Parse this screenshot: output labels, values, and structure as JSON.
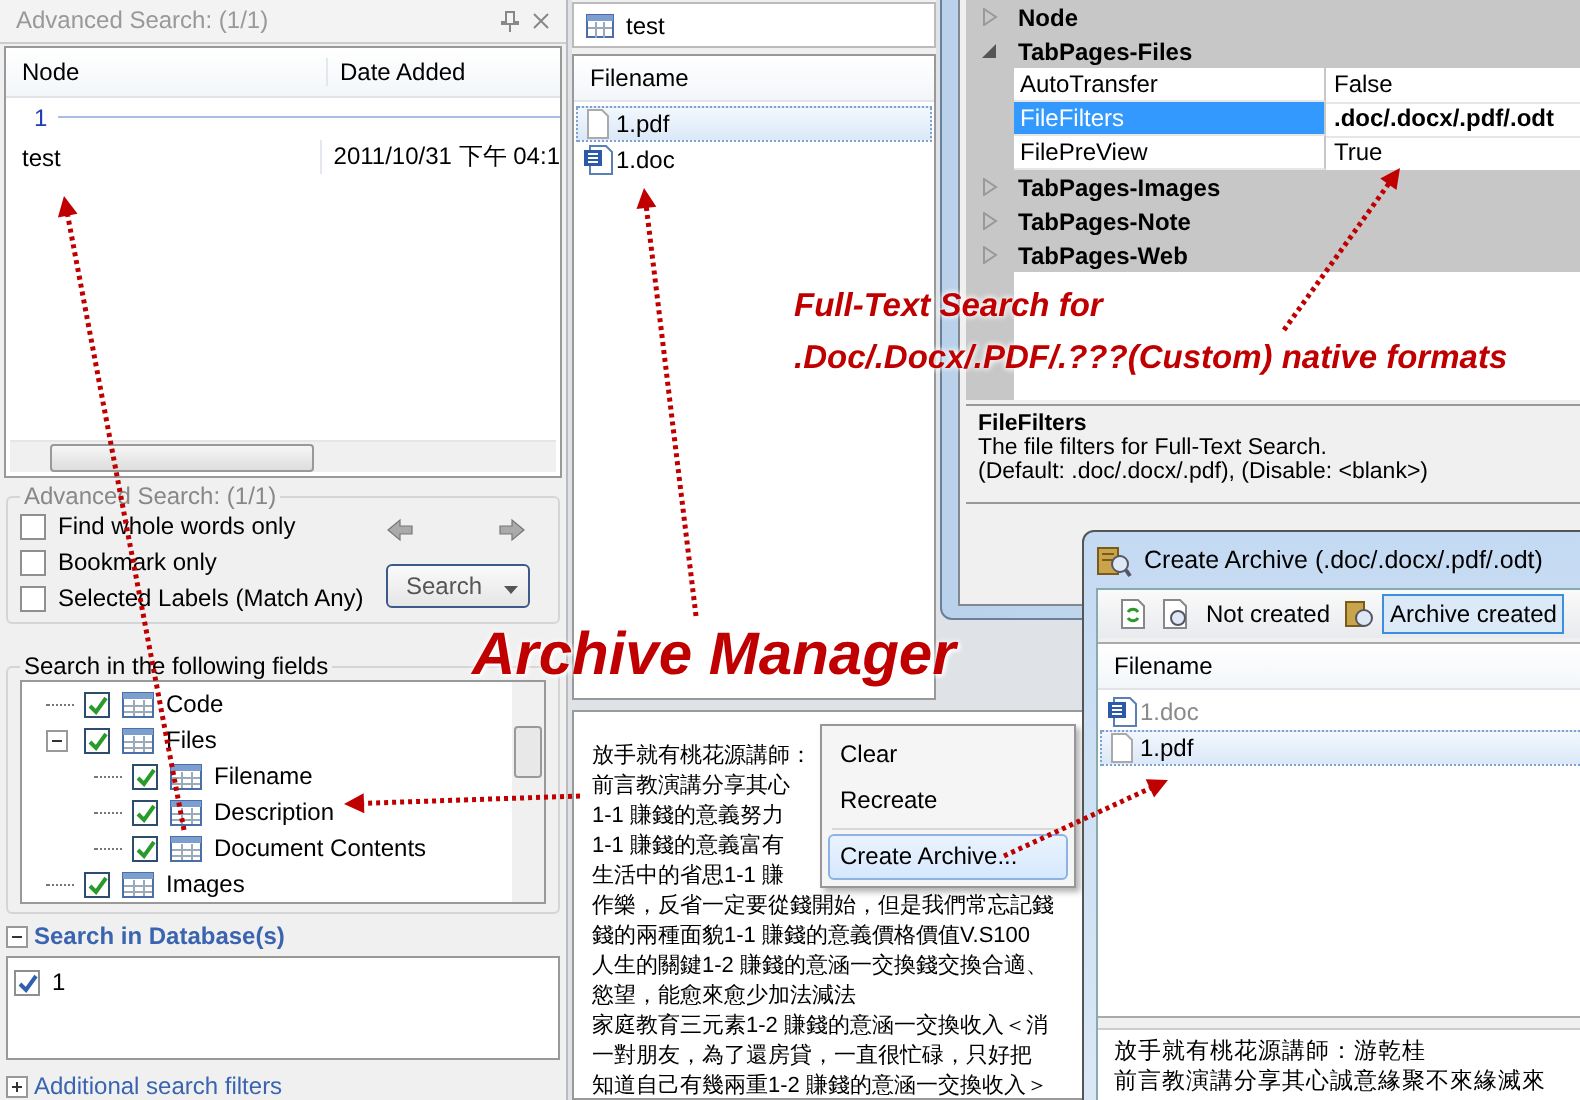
{
  "search_panel": {
    "title": "Advanced Search: (1/1)",
    "list": {
      "columns": [
        "Node",
        "Date Added"
      ],
      "group": "1",
      "rows": [
        {
          "node": "test",
          "date": "2011/10/31 下午 04:1"
        }
      ]
    },
    "options": {
      "title": "Advanced Search: (1/1)",
      "checkboxes": [
        {
          "label": "Find whole words only",
          "checked": false
        },
        {
          "label": "Bookmark only",
          "checked": false
        },
        {
          "label": "Selected Labels (Match Any)",
          "checked": false
        }
      ],
      "search_button": "Search"
    },
    "fields": {
      "title": "Search in the following fields",
      "tree": [
        {
          "label": "Code",
          "checked": true
        },
        {
          "label": "Files",
          "checked": true,
          "expanded": true,
          "children": [
            {
              "label": "Filename",
              "checked": true
            },
            {
              "label": "Description",
              "checked": true
            },
            {
              "label": "Document Contents",
              "checked": true
            }
          ]
        },
        {
          "label": "Images",
          "checked": true
        }
      ]
    },
    "databases": {
      "title": "Search in Database(s)",
      "expanded": true,
      "items": [
        {
          "label": "1",
          "checked": true
        }
      ]
    },
    "filters": {
      "title": "Additional search filters",
      "expanded": false
    }
  },
  "file_panel": {
    "tab": "test",
    "column": "Filename",
    "rows": [
      {
        "name": "1.pdf",
        "kind": "pdf",
        "selected": true
      },
      {
        "name": "1.doc",
        "kind": "doc",
        "selected": false
      }
    ],
    "preview": [
      "放手就有桃花源講師：",
      "前言教演講分享其心",
      "1-1 賺錢的意義努力",
      "1-1 賺錢的意義富有",
      "生活中的省思1-1 賺",
      "作樂，反省一定要從錢開始，但是我們常忘記錢",
      "錢的兩種面貌1-1 賺錢的意義價格價值V.S100",
      "人生的關鍵1-2 賺錢的意涵一交換錢交換合適、",
      "慾望，能愈來愈少加法減法",
      "家庭教育三元素1-2 賺錢的意涵一交換收入＜消",
      "一對朋友，為了還房貸，一直很忙碌，只好把",
      "知道自己有幾兩重1-2 賺錢的意涵一交換收入＞"
    ]
  },
  "context_menu": {
    "items": [
      {
        "kind": "item",
        "label": "Clear",
        "selected": false
      },
      {
        "kind": "item",
        "label": "Recreate",
        "selected": false
      },
      {
        "kind": "separator"
      },
      {
        "kind": "item",
        "label": "Create Archive...",
        "selected": true
      }
    ]
  },
  "property_grid": {
    "categories": [
      {
        "name": "Node",
        "expanded": false
      },
      {
        "name": "TabPages-Files",
        "expanded": true,
        "properties": [
          {
            "name": "AutoTransfer",
            "value": "False",
            "selected": false,
            "modified": false
          },
          {
            "name": "FileFilters",
            "value": ".doc/.docx/.pdf/.odt",
            "selected": true,
            "modified": true
          },
          {
            "name": "FilePreView",
            "value": "True",
            "selected": false,
            "modified": false
          }
        ]
      },
      {
        "name": "TabPages-Images",
        "expanded": false
      },
      {
        "name": "TabPages-Note",
        "expanded": false
      },
      {
        "name": "TabPages-Web",
        "expanded": false
      }
    ],
    "description": {
      "title": "FileFilters",
      "lines": [
        "The file filters for Full-Text Search.",
        "(Default: .doc/.docx/.pdf), (Disable: <blank>)"
      ]
    }
  },
  "archive_window": {
    "title": "Create Archive (.doc/.docx/.pdf/.odt)",
    "toolbar": [
      {
        "kind": "refresh"
      },
      {
        "kind": "toggle",
        "label": "Not created",
        "selected": false
      },
      {
        "kind": "toggle",
        "label": "Archive created",
        "selected": true
      }
    ],
    "column": "Filename",
    "rows": [
      {
        "name": "1.doc",
        "kind": "doc",
        "dimmed": true,
        "selected": false
      },
      {
        "name": "1.pdf",
        "kind": "pdf",
        "dimmed": false,
        "selected": true
      }
    ],
    "preview": [
      "放手就有桃花源講師：游乾桂",
      "前言教演講分享其心誠意緣聚不來緣滅來"
    ]
  },
  "annotations": {
    "headline": "Archive Manager",
    "note": [
      "Full-Text Search for",
      ".Doc/.Docx/.PDF/.???(Custom) native formats"
    ]
  }
}
